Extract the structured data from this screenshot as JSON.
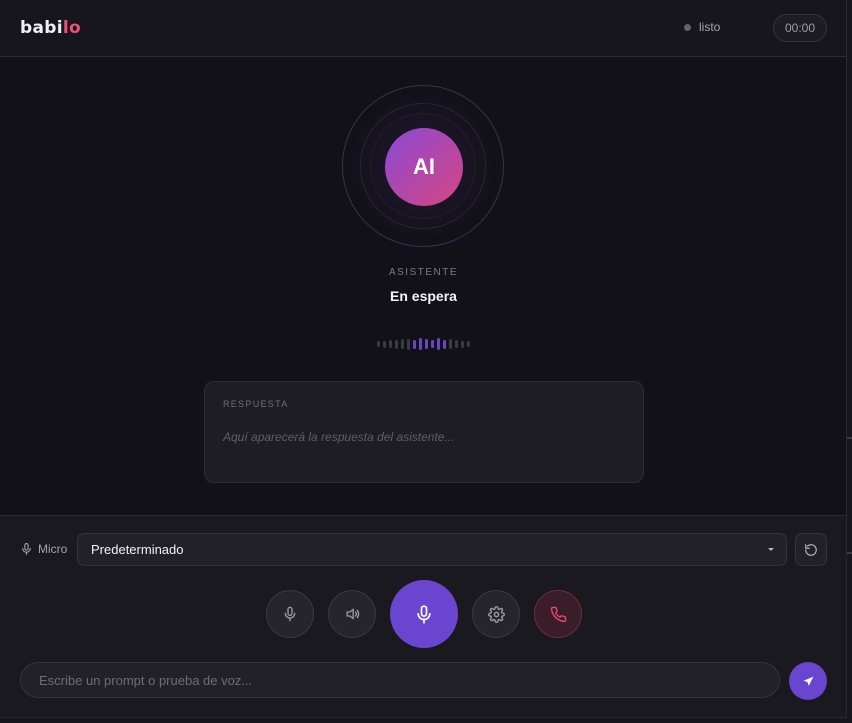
{
  "app": {
    "brand_prefix": "babi",
    "brand_suffix": "lo",
    "status": "listo",
    "timer": "00:00"
  },
  "assistant": {
    "avatar": "AI",
    "role": "ASISTENTE",
    "state": "En espera"
  },
  "voice_level": {
    "bars": 16,
    "active_from": 6,
    "active_to": 11
  },
  "response": {
    "label": "RESPUESTA",
    "placeholder": "Aquí aparecerá la respuesta del asistente..."
  },
  "microphone": {
    "label": "Micro",
    "selected_device": "Predeterminado"
  },
  "prompt": {
    "placeholder": "Escribe un prompt o prueba de voz..."
  },
  "icons": {
    "mic_label": "microphone-icon",
    "refresh": "refresh-icon",
    "mute": "microphone-icon",
    "speaker": "speaker-icon",
    "talk": "microphone-icon",
    "settings": "gear-icon",
    "hangup": "phone-icon",
    "send": "send-icon"
  },
  "colors": {
    "accent": "#6a46d0",
    "brand_accent": "#ee4f7b",
    "danger": "#e04a6e",
    "background": "#141319"
  }
}
